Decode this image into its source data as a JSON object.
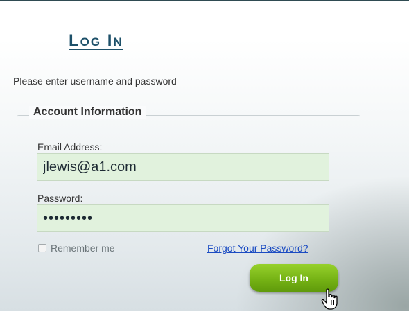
{
  "header": {
    "title": "Log In"
  },
  "instructions": "Please enter username and password",
  "form": {
    "legend": "Account Information",
    "email": {
      "label": "Email Address:",
      "value": "jlewis@a1.com"
    },
    "password": {
      "label": "Password:",
      "masked_value": "•••••••••"
    },
    "remember": {
      "label": "Remember me",
      "checked": false
    },
    "forgot_link": "Forgot Your Password?",
    "submit_label": "Log In"
  },
  "colors": {
    "title": "#1d5069",
    "input_bg": "#e1f2dd",
    "link": "#1a4bc2",
    "button": "#76b315"
  },
  "icons": {
    "cursor": "hand-pointer-icon"
  }
}
